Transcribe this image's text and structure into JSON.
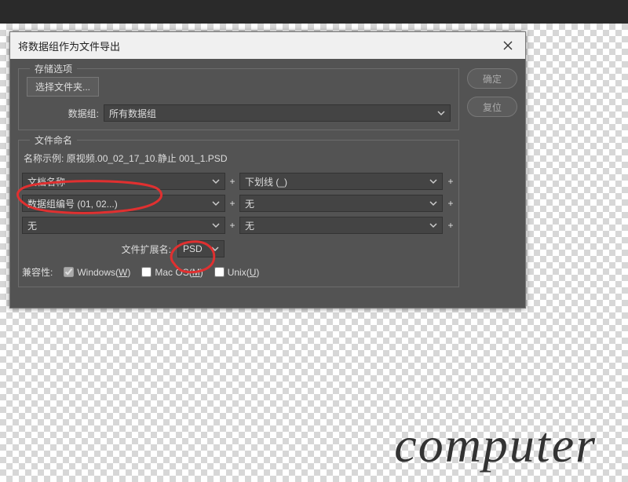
{
  "dialog": {
    "title": "将数据组作为文件导出",
    "ok_label": "确定",
    "reset_label": "复位"
  },
  "storage": {
    "legend": "存储选项",
    "choose_folder_label": "选择文件夹...",
    "dataset_label": "数据组:",
    "dataset_value": "所有数据组"
  },
  "naming": {
    "legend": "文件命名",
    "example_label": "名称示例:",
    "example_value": "原视频.00_02_17_10.静止 001_1.PSD",
    "rows": [
      {
        "left": "文档名称",
        "right": "下划线 (_)"
      },
      {
        "left": "数据组编号 (01, 02...)",
        "right": "无"
      },
      {
        "left": "无",
        "right": "无"
      }
    ],
    "extension_label": "文件扩展名:",
    "extension_value": "PSD"
  },
  "compat": {
    "label": "兼容性:",
    "windows": "Windows(W)",
    "mac": "Mac OS(M)",
    "unix": "Unix(U)"
  },
  "watermark": "computer"
}
